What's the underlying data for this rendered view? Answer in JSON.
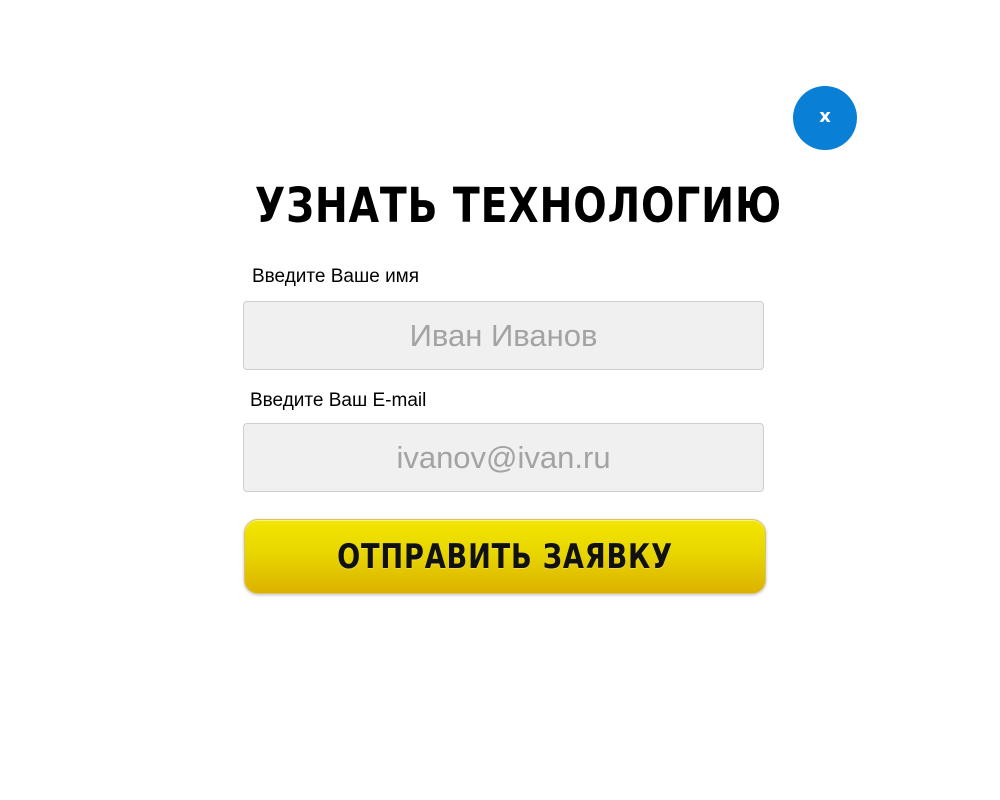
{
  "modal": {
    "close_label": "x",
    "title": "УЗНАТЬ ТЕХНОЛОГИЮ",
    "name_label": "Введите Ваше имя",
    "name_placeholder": "Иван Иванов",
    "email_label": "Введите Ваш E-mail",
    "email_placeholder": "ivanov@ivan.ru",
    "submit_label": "ОТПРАВИТЬ ЗАЯВКУ"
  },
  "colors": {
    "close_button": "#0a7fd6",
    "submit_gradient_top": "#f2e600",
    "submit_gradient_bottom": "#dcb200",
    "field_background": "#f0f0f0"
  },
  "icons": {
    "close": "close-icon"
  }
}
